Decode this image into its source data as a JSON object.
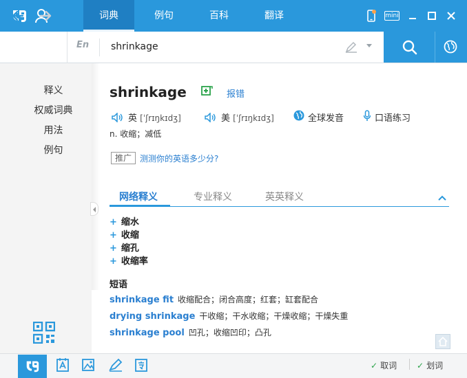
{
  "nav_tabs": [
    {
      "label": "词典",
      "active": true
    },
    {
      "label": "例句",
      "active": false
    },
    {
      "label": "百科",
      "active": false
    },
    {
      "label": "翻译",
      "active": false
    }
  ],
  "window_controls": {
    "mini_label": "mini"
  },
  "search": {
    "lang": "En",
    "query": "shrinkage"
  },
  "sidebar": {
    "items": [
      "释义",
      "权威词典",
      "用法",
      "例句"
    ]
  },
  "entry": {
    "word": "shrinkage",
    "report_label": "报错",
    "uk_label": "英",
    "uk_phonetic": "[ˈʃrɪŋkɪdʒ]",
    "us_label": "美",
    "us_phonetic": "[ˈʃrɪŋkɪdʒ]",
    "global_pron_label": "全球发音",
    "oral_practice_label": "口语练习",
    "definition": "n. 收缩；减低"
  },
  "ad": {
    "tag": "推广",
    "link": "测测你的英语多少分?"
  },
  "def_tabs": [
    {
      "label": "网络释义",
      "active": true
    },
    {
      "label": "专业释义",
      "active": false
    },
    {
      "label": "英英释义",
      "active": false
    }
  ],
  "web_meanings": [
    "缩水",
    "收缩",
    "缩孔",
    "收缩率"
  ],
  "phrases": {
    "heading": "短语",
    "items": [
      {
        "en": "shrinkage fit",
        "zh": "收缩配合；闭合高度；红套；缸套配合"
      },
      {
        "en": "drying shrinkage",
        "zh": "干收缩；干水收缩；干燥收缩；干燥失重"
      },
      {
        "en": "shrinkage pool",
        "zh": "凹孔；收缩凹印；凸孔"
      }
    ]
  },
  "bottom": {
    "toggle_pick": "取词",
    "toggle_select": "划词"
  },
  "colors": {
    "accent": "#2a98dc",
    "link": "#2a7fd0",
    "check": "#2aa34a"
  }
}
